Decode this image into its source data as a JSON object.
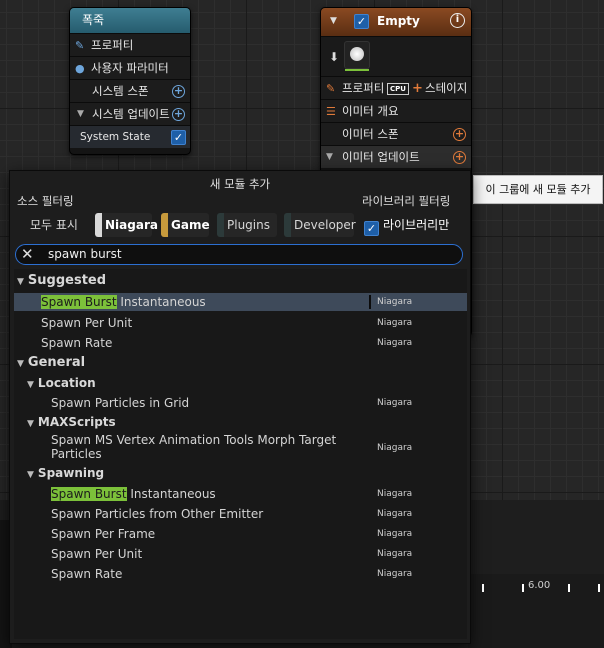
{
  "node_firework": {
    "title": "폭죽",
    "rows": {
      "properties": "프로퍼티",
      "user_params": "사용자 파라미터",
      "system_spawn": "시스템 스폰",
      "system_update": "시스템 업데이트",
      "system_state": "System State"
    }
  },
  "node_empty": {
    "title": "Empty",
    "properties": "프로퍼티",
    "cpu": "CPU",
    "stage": "스테이지",
    "emitter_summary": "이미터 개요",
    "emitter_spawn": "이미터 스폰",
    "emitter_update": "이미터 업데이트"
  },
  "tooltip": "이 그룹에 새 모듈 추가",
  "popup": {
    "title": "새 모듈 추가",
    "source_filter": "소스 필터링",
    "library_filter": "라이브러리 필터링",
    "filters": {
      "show_all": "모두 표시",
      "niagara": "Niagara",
      "game": "Game",
      "plugins": "Plugins",
      "developer": "Developer"
    },
    "library_only": "라이브러리만",
    "search_value": "spawn burst",
    "categories": {
      "suggested": "Suggested",
      "general": "General",
      "location": "Location",
      "maxscripts": "MAXScripts",
      "spawning": "Spawning"
    },
    "items": {
      "s1_hl": "Spawn Burst",
      "s1_rest": " Instantaneous",
      "s2": "Spawn Per Unit",
      "s3": "Spawn Rate",
      "l1": "Spawn Particles in Grid",
      "m1": "Spawn MS Vertex Animation Tools Morph Target Particles",
      "p1_hl": "Spawn Burst",
      "p1_rest": " Instantaneous",
      "p2": "Spawn Particles from Other Emitter",
      "p3": "Spawn Per Frame",
      "p4": "Spawn Per Unit",
      "p5": "Spawn Rate"
    },
    "source_tag": "Niagara"
  },
  "timeline": {
    "tick_label": "6.00"
  },
  "colors": {
    "accent": "#2c6fd1",
    "highlight": "#7cc13a",
    "niagara_chip": "#d9d9d9",
    "game_chip": "#c79a3c",
    "emitter_header": "#8a4a22",
    "system_header": "#3f7e92"
  }
}
